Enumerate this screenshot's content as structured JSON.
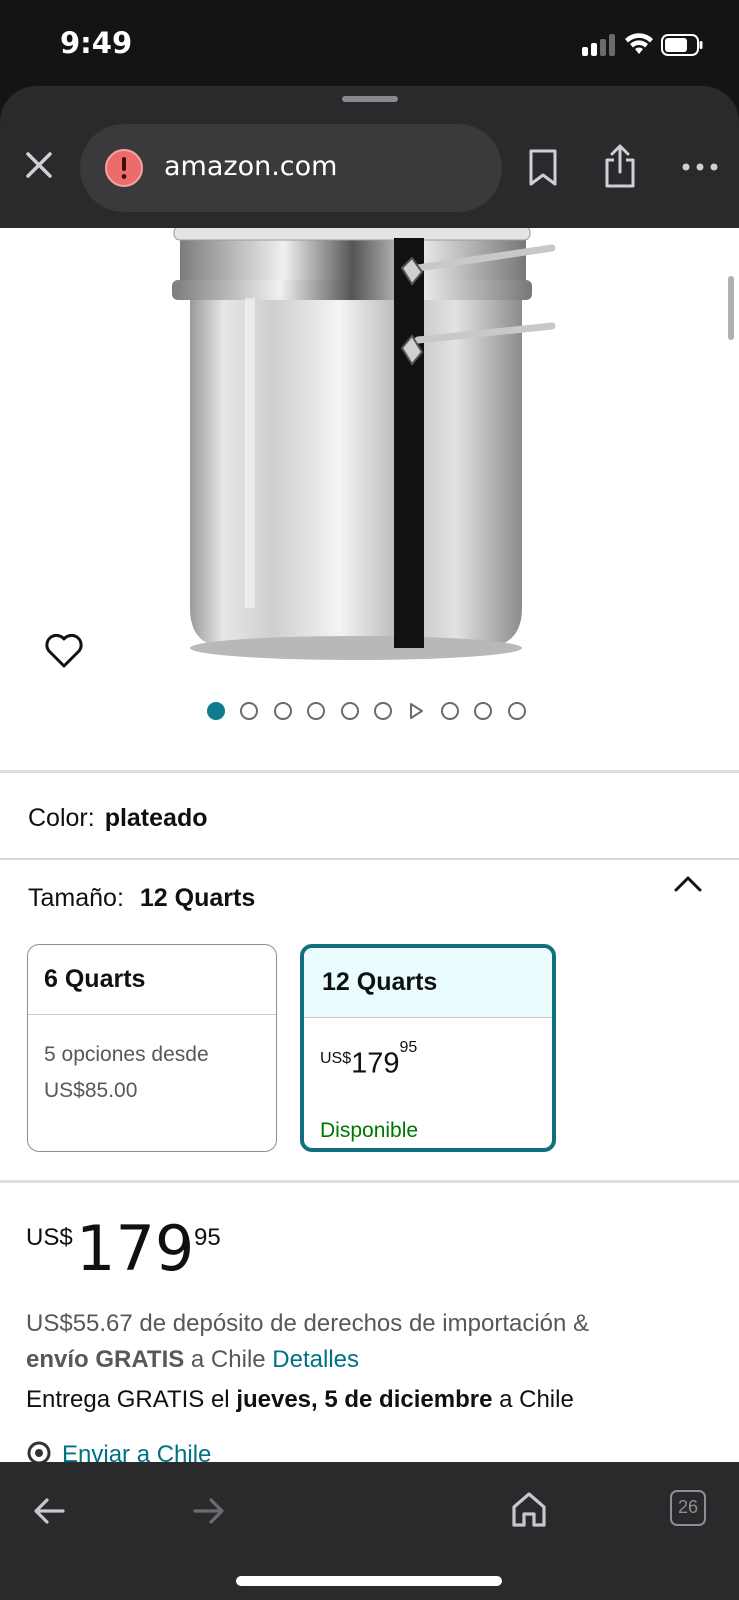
{
  "status": {
    "time": "9:49"
  },
  "browser": {
    "url": "amazon.com",
    "tab_count": "26"
  },
  "product": {
    "color_label": "Color:",
    "color_value": "plateado",
    "size_label": "Tamaño:",
    "size_value": "12 Quarts",
    "size_options": [
      {
        "name": "6 Quarts",
        "line1": "5 opciones desde",
        "line2": "US$85.00"
      },
      {
        "name": "12 Quarts",
        "currency": "US$",
        "whole": "179",
        "cents": "95",
        "availability": "Disponible"
      }
    ],
    "price": {
      "currency": "US$",
      "whole": "179",
      "cents": "95"
    },
    "import_text": "US$55.67 de depósito de derechos de importación &",
    "free_shipping_bold": "envío GRATIS",
    "to_country": " a Chile ",
    "details_link": "Detalles",
    "delivery_prefix": "Entrega GRATIS el ",
    "delivery_date": "jueves, 5 de diciembre",
    "delivery_suffix": " a Chile",
    "ship_to_link": "Enviar a Chile"
  },
  "carousel": {
    "dot_count": 10,
    "active_index": 0,
    "video_index": 6
  },
  "colors": {
    "accent": "#0f7d8e",
    "link": "#007185",
    "available": "#007600",
    "chrome": "#2a2a2c"
  }
}
